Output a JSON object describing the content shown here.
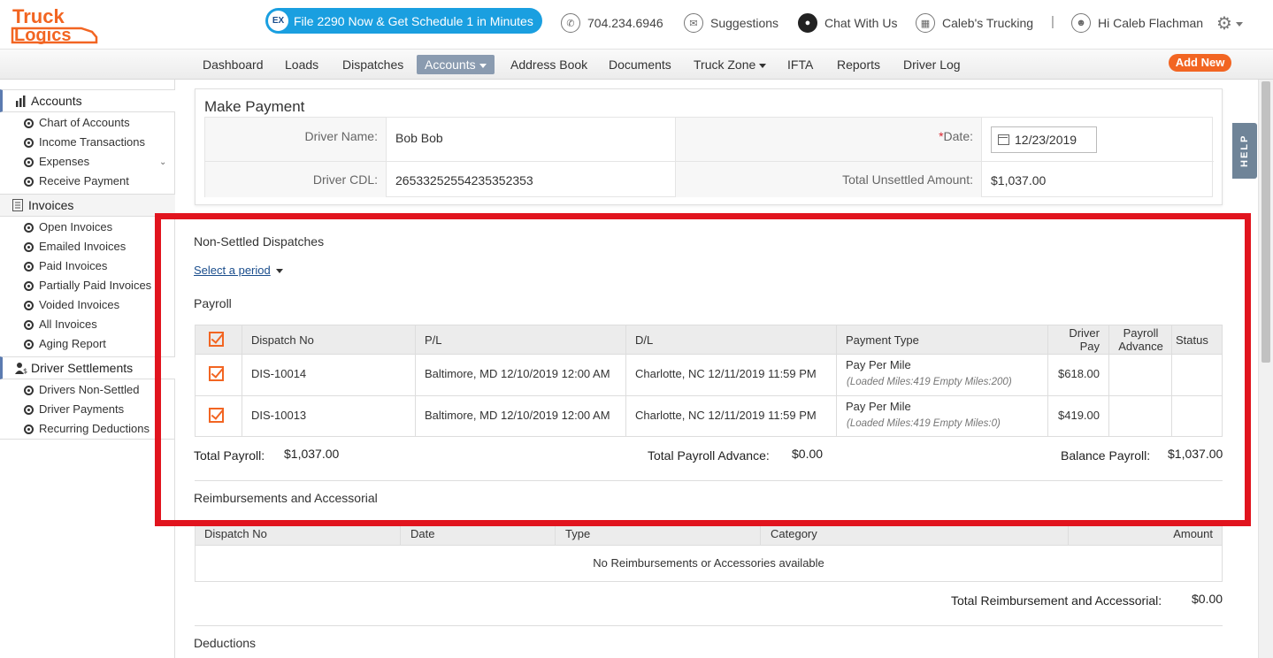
{
  "header": {
    "logo_text_top": "Truck",
    "logo_text_bottom": "Logics",
    "promo_badge": "EX",
    "promo": "File 2290 Now & Get Schedule 1 in Minutes",
    "phone": "704.234.6946",
    "suggestions": "Suggestions",
    "chat": "Chat With Us",
    "company": "Caleb's Trucking",
    "separator": "|",
    "greeting": "Hi Caleb Flachman"
  },
  "nav": {
    "items": [
      "Dashboard",
      "Loads",
      "Dispatches",
      "Accounts",
      "Address Book",
      "Documents",
      "Truck Zone",
      "IFTA",
      "Reports",
      "Driver Log"
    ],
    "active": "Accounts",
    "add_new": "Add New"
  },
  "sidebar": {
    "accounts": "Accounts",
    "accounts_items": [
      "Chart of Accounts",
      "Income Transactions",
      "Expenses",
      "Receive Payment"
    ],
    "invoices": "Invoices",
    "invoices_items": [
      "Open Invoices",
      "Emailed Invoices",
      "Paid Invoices",
      "Partially Paid Invoices",
      "Voided Invoices",
      "All Invoices",
      "Aging Report"
    ],
    "settlements": "Driver Settlements",
    "settlements_items": [
      "Drivers Non-Settled",
      "Driver Payments",
      "Recurring Deductions"
    ]
  },
  "payment": {
    "title": "Make Payment",
    "driver_name_label": "Driver Name:",
    "driver_name": "Bob Bob",
    "date_label_req": "*",
    "date_label": "Date:",
    "date": "12/23/2019",
    "cdl_label": "Driver CDL:",
    "cdl": "26533252554235352353",
    "unsettled_label": "Total Unsettled Amount:",
    "unsettled": "$1,037.00"
  },
  "help": "HELP",
  "nonsettled": {
    "title": "Non-Settled Dispatches",
    "period": "Select a period",
    "payroll_title": "Payroll",
    "columns": [
      "Dispatch No",
      "P/L",
      "D/L",
      "Payment Type",
      "Driver Pay",
      "Payroll Advance",
      "Status"
    ],
    "col_driver_pay_1": "Driver",
    "col_driver_pay_2": "Pay",
    "col_adv_1": "Payroll",
    "col_adv_2": "Advance",
    "rows": [
      {
        "dispatch": "DIS-10014",
        "pl": "Baltimore, MD 12/10/2019 12:00 AM",
        "dl": "Charlotte, NC 12/11/2019 11:59 PM",
        "pay_type": "Pay Per Mile",
        "pay_detail": "(Loaded Miles:419 Empty Miles:200)",
        "driver_pay": "$618.00",
        "advance": "",
        "status": ""
      },
      {
        "dispatch": "DIS-10013",
        "pl": "Baltimore, MD 12/10/2019 12:00 AM",
        "dl": "Charlotte, NC 12/11/2019 11:59 PM",
        "pay_type": "Pay Per Mile",
        "pay_detail": "(Loaded Miles:419 Empty Miles:0)",
        "driver_pay": "$419.00",
        "advance": "",
        "status": ""
      }
    ],
    "total_payroll_label": "Total Payroll:",
    "total_payroll": "$1,037.00",
    "total_advance_label": "Total Payroll Advance:",
    "total_advance": "$0.00",
    "balance_label": "Balance Payroll:",
    "balance": "$1,037.00"
  },
  "reimbursements": {
    "title": "Reimbursements and Accessorial",
    "columns": [
      "Dispatch No",
      "Date",
      "Type",
      "Category",
      "Amount"
    ],
    "empty": "No Reimbursements or Accessories available",
    "total_label": "Total Reimbursement and Accessorial:",
    "total": "$0.00"
  },
  "deductions": {
    "title": "Deductions"
  },
  "colors": {
    "accent_orange": "#f26522",
    "promo_blue": "#1a9fe0",
    "highlight_red": "#e1141e",
    "nav_active": "#8a9bb0"
  }
}
